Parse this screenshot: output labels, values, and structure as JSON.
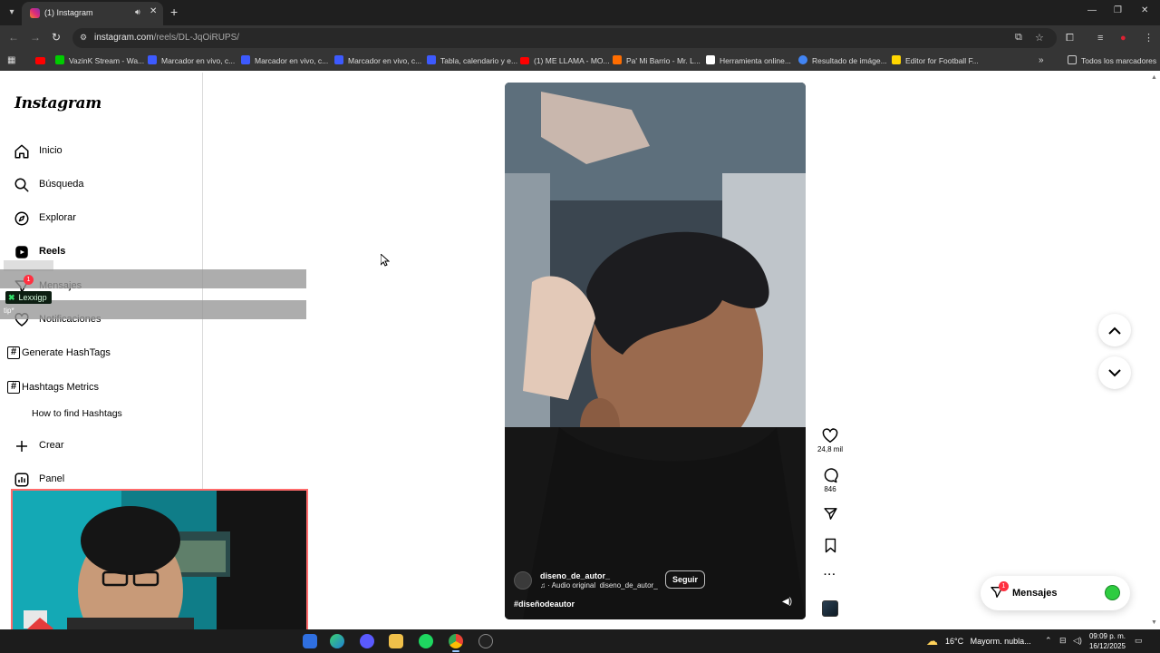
{
  "browser": {
    "tab_title": "(1) Instagram",
    "url_host": "instagram.com",
    "url_path": "/reels/DL-JqOiRUPS/",
    "bookmarks": [
      {
        "label": "VazinK Stream - Wa...",
        "color": "#0f0"
      },
      {
        "label": "Marcador en vivo, c...",
        "color": "#3d5afe"
      },
      {
        "label": "Marcador en vivo, c...",
        "color": "#3d5afe"
      },
      {
        "label": "Marcador en vivo, c...",
        "color": "#3d5afe"
      },
      {
        "label": "Tabla, calendario y e...",
        "color": "#3d5afe"
      },
      {
        "label": "(1) ME LLAMA - MO...",
        "color": "#ff0000"
      },
      {
        "label": "Pa' Mi Barrio - Mr. L...",
        "color": "#ff6d00"
      },
      {
        "label": "Herramienta online...",
        "color": "#ffffff"
      },
      {
        "label": "Resultado de imáge...",
        "color": "#4285f4"
      },
      {
        "label": "Editor for Football F...",
        "color": "#ffd600"
      }
    ],
    "all_bookmarks": "Todos los marcadores"
  },
  "sidebar": {
    "logo": "Instagram",
    "items": [
      {
        "label": "Inicio",
        "icon": "home-icon"
      },
      {
        "label": "Búsqueda",
        "icon": "search-icon"
      },
      {
        "label": "Explorar",
        "icon": "compass-icon"
      },
      {
        "label": "Reels",
        "icon": "reels-icon"
      },
      {
        "label": "Mensajes",
        "icon": "messenger-icon"
      },
      {
        "label": "Notificaciones",
        "icon": "heart-icon"
      }
    ],
    "hashtag_items": [
      {
        "label": "Generate HashTags"
      },
      {
        "label": "Hashtags Metrics"
      }
    ],
    "how_to": "How to find Hashtags",
    "create": "Crear",
    "panel": "Panel",
    "messages_badge": "1"
  },
  "overlay": {
    "tag_name": "Lexxigp",
    "tip": "tip*"
  },
  "reel": {
    "username": "diseno_de_autor_",
    "audio": "· Audio original",
    "audio_user": "diseno_de_autor_",
    "follow": "Seguir",
    "caption": "#diseñodeautor",
    "likes": "24,8 mil",
    "comments": "846"
  },
  "messages_pill": {
    "label": "Mensajes",
    "badge": "1"
  },
  "taskbar": {
    "temperature": "16°C",
    "weather_text": "Mayorm. nubla...",
    "time": "09:09 p. m.",
    "date": "16/12/2025"
  },
  "colors": {
    "ig_red": "#ff3040",
    "chrome_dark": "#353535",
    "tabbar": "#1f1f1f"
  }
}
